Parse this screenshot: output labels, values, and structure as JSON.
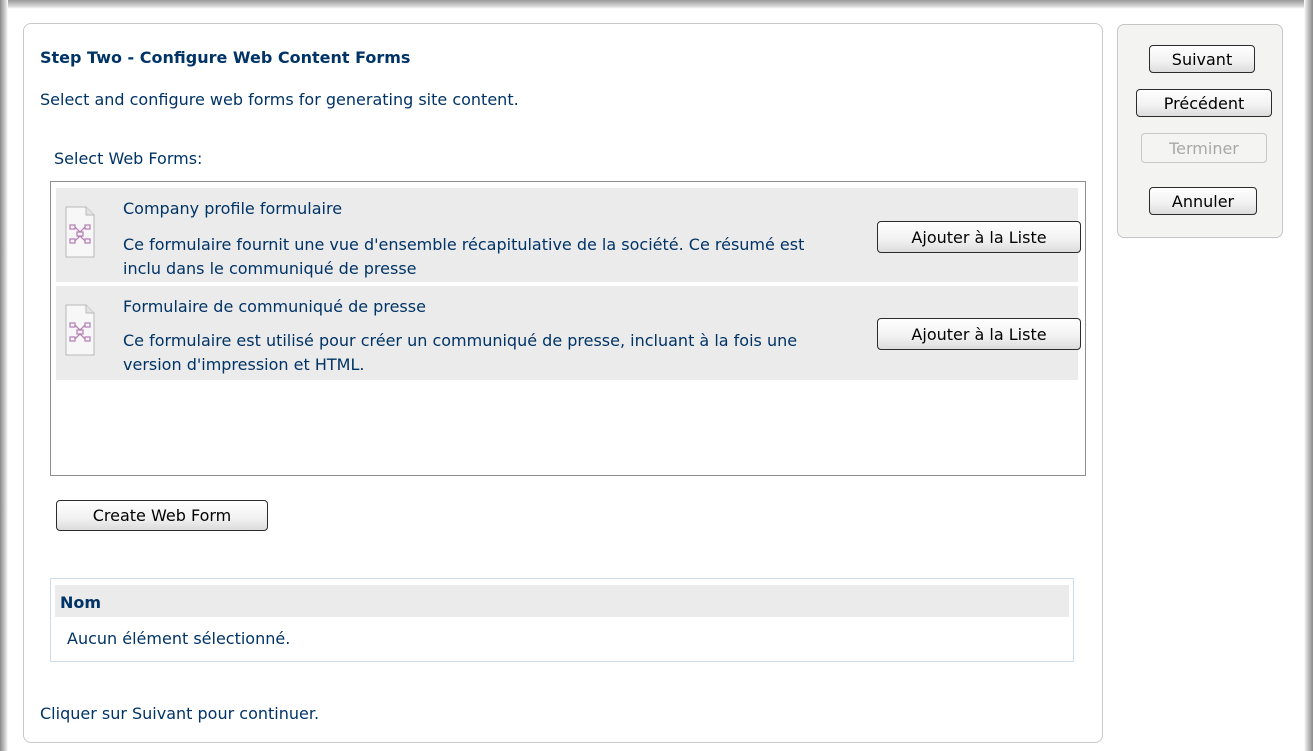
{
  "page": {
    "title": "Step Two - Configure Web Content Forms",
    "subtitle": "Select and configure web forms for generating site content.",
    "forms_label": "Select Web Forms:",
    "footer": "Cliquer sur Suivant pour continuer."
  },
  "forms": [
    {
      "icon": "web-form-icon",
      "name": "Company profile formulaire",
      "description": "Ce formulaire fournit une vue d'ensemble récapitulative de la société. Ce résumé est inclu dans le communiqué de presse",
      "button": "Ajouter à la Liste"
    },
    {
      "icon": "web-form-icon",
      "name": "Formulaire de communiqué de presse",
      "description": "Ce formulaire est utilisé pour créer un communiqué de presse, incluant à la fois une version d'impression et HTML.",
      "button": "Ajouter à la Liste"
    }
  ],
  "create_button": "Create Web Form",
  "selected_list": {
    "header": "Nom",
    "empty": "Aucun élément sélectionné."
  },
  "wizard": {
    "next": "Suivant",
    "previous": "Précédent",
    "finish": "Terminer",
    "finish_enabled": false,
    "cancel": "Annuler"
  },
  "colors": {
    "text": "#003366",
    "row_background": "#ebebeb",
    "panel_background": "#f3f3f1",
    "disabled_text": "#a8a8a8"
  }
}
